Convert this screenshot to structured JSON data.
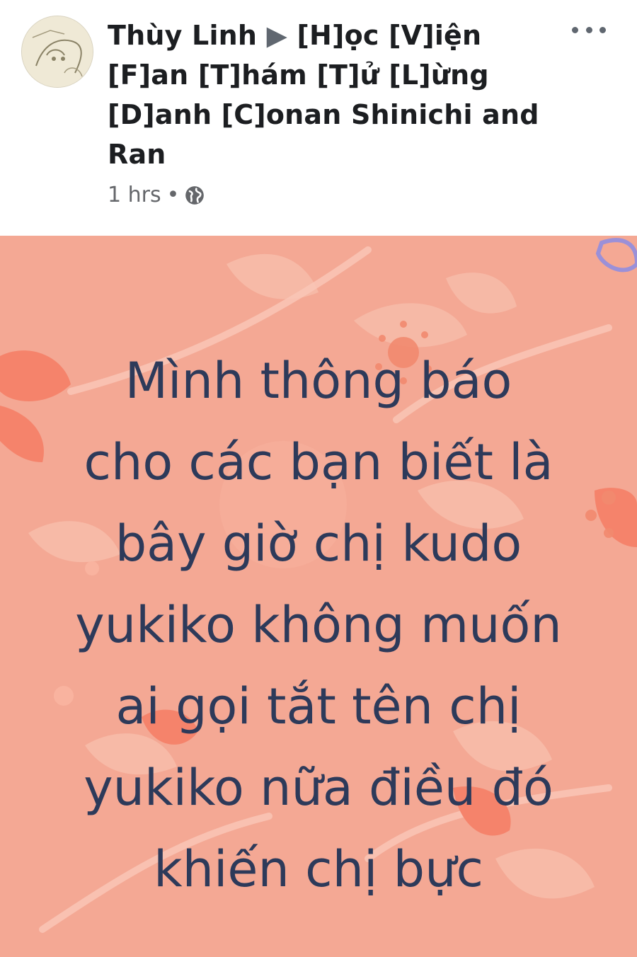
{
  "post": {
    "author": "Thùy Linh",
    "separator": "▶",
    "group": "[H]ọc [V]iện [F]an [T]hám [T]ử [L]ừng [D]anh [C]onan  Shinichi and Ran",
    "time": "1 hrs",
    "dot": "•",
    "privacy_icon": "globe-icon",
    "more_icon": "more-icon"
  },
  "image_text": "Mình thông báo\ncho các bạn biết là\nbây giờ chị kudo\nyukiko không muốn\nai gọi tắt tên chị\nyukiko nữa điều đó\nkhiến chị bực",
  "colors": {
    "background_card": "#f4a894",
    "text": "#2d3a5a",
    "meta": "#65676b"
  }
}
